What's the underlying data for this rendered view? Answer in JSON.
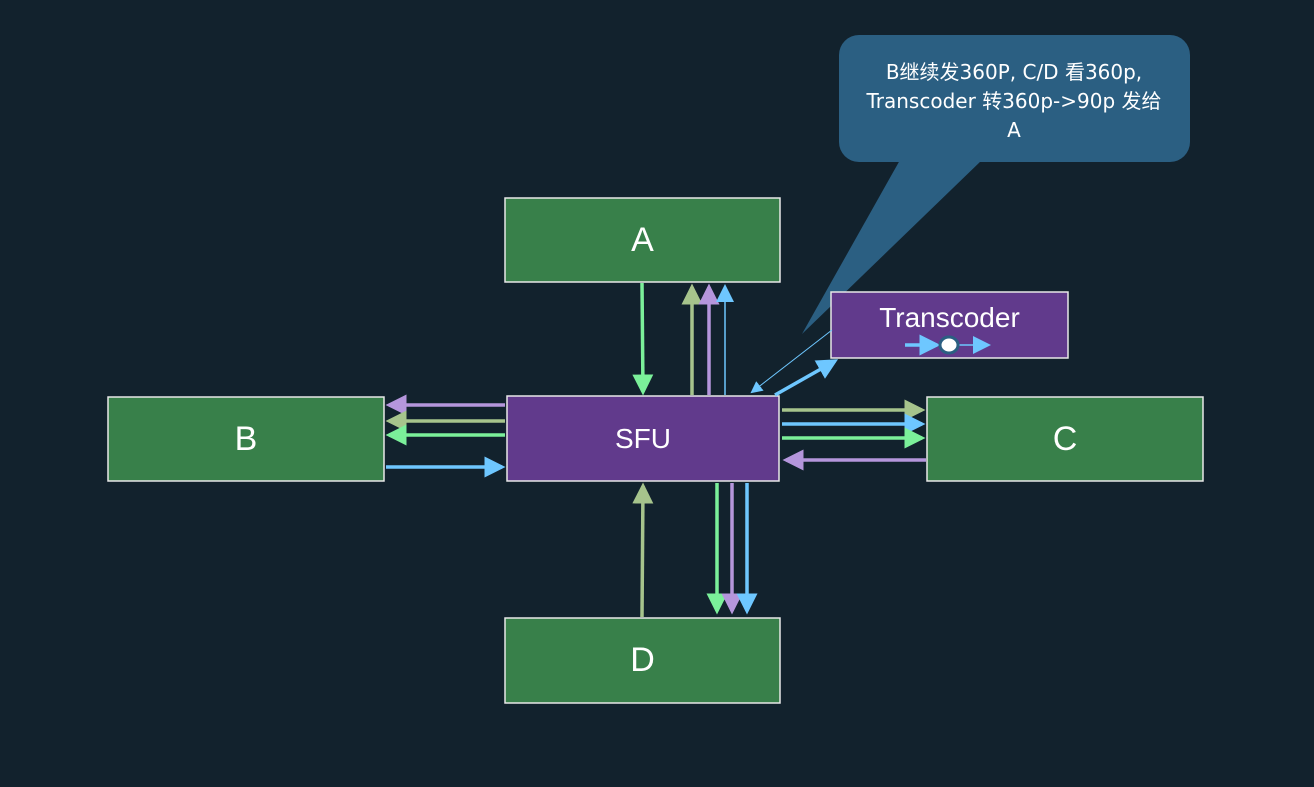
{
  "nodes": {
    "a": "A",
    "b": "B",
    "c": "C",
    "d": "D",
    "sfu": "SFU",
    "transcoder": "Transcoder"
  },
  "callout": {
    "lines": [
      "B继续发360P, C/D 看360p,",
      "Transcoder 转360p->90p 发给",
      "A"
    ]
  },
  "colors": {
    "background": "#12222d",
    "client_box": "#38804a",
    "server_box": "#613a8c",
    "callout": "#2b5f82",
    "stream_green_bright": "#7bf09a",
    "stream_green_olive": "#a6c48c",
    "stream_purple": "#b596dc",
    "stream_blue": "#6ec7ff"
  }
}
